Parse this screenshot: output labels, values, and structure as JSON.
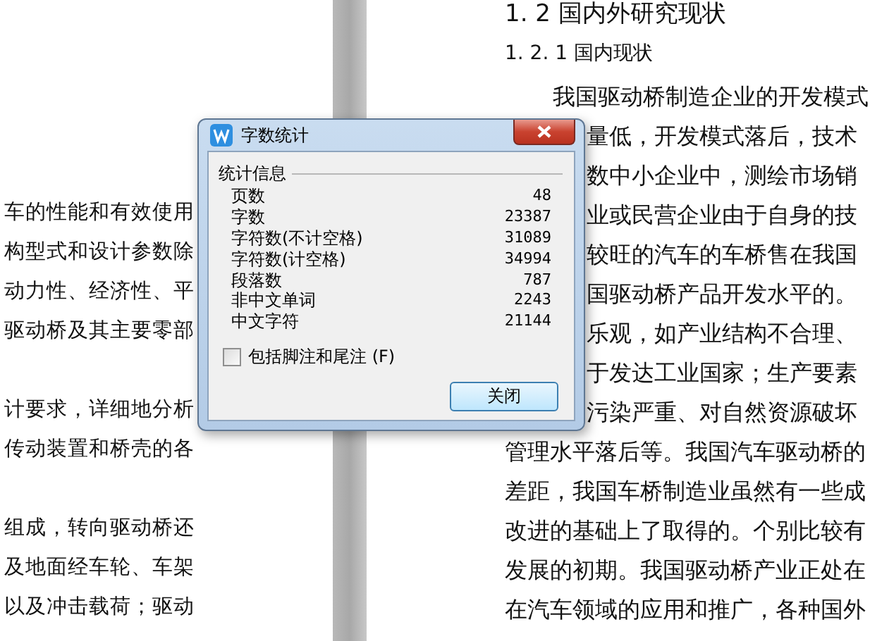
{
  "left_page": {
    "paragraphs": [
      [
        "车的性能和有效使用",
        "构型式和设计参数除",
        "动力性、经济性、平",
        "驱动桥及其主要零部"
      ],
      [
        "计要求，详细地分析",
        "传动装置和桥壳的各"
      ],
      [
        "组成，转向驱动桥还",
        "及地面经车轮、车架",
        "以及冲击载荷；驱动"
      ]
    ]
  },
  "right_page": {
    "heading": "1. 2 国内外研究现状",
    "subheading": "1. 2. 1 国内现状",
    "lines": [
      {
        "kind": "indent",
        "text": "我国驱动桥制造企业的开发模式"
      },
      {
        "kind": "beside",
        "text": "量低，开发模式落后，技术"
      },
      {
        "kind": "beside",
        "text": "数中小企业中，测绘市场销"
      },
      {
        "kind": "beside",
        "text": "业或民营企业由于自身的技"
      },
      {
        "kind": "beside",
        "text": "较旺的汽车的车桥售在我国"
      },
      {
        "kind": "beside",
        "text": "国驱动桥产品开发水平的。"
      },
      {
        "kind": "beside",
        "text": "乐观，如产业结构不合理、"
      },
      {
        "kind": "beside",
        "text": "于发达工业国家；生产要素"
      },
      {
        "kind": "beside",
        "text": "污染严重、对自然资源破坏"
      },
      {
        "kind": "full",
        "text": "管理水平落后等。我国汽车驱动桥的"
      },
      {
        "kind": "full",
        "text": "差距，我国车桥制造业虽然有一些成"
      },
      {
        "kind": "full",
        "text": "改进的基础上了取得的。个别比较有"
      },
      {
        "kind": "full",
        "text": "发展的初期。我国驱动桥产业正处在"
      },
      {
        "kind": "full",
        "text": "在汽车领域的应用和推广，各种国外"
      }
    ]
  },
  "dialog": {
    "title": "字数统计",
    "group": "统计信息",
    "stats": [
      {
        "label": "页数",
        "value": "48"
      },
      {
        "label": "字数",
        "value": "23387"
      },
      {
        "label": "字符数(不计空格)",
        "value": "31089"
      },
      {
        "label": "字符数(计空格)",
        "value": "34994"
      },
      {
        "label": "段落数",
        "value": "787"
      },
      {
        "label": "非中文单词",
        "value": "2243"
      },
      {
        "label": "中文字符",
        "value": "21144"
      }
    ],
    "checkbox": {
      "label": "包括脚注和尾注 (F)",
      "checked": false
    },
    "button": "关闭"
  }
}
